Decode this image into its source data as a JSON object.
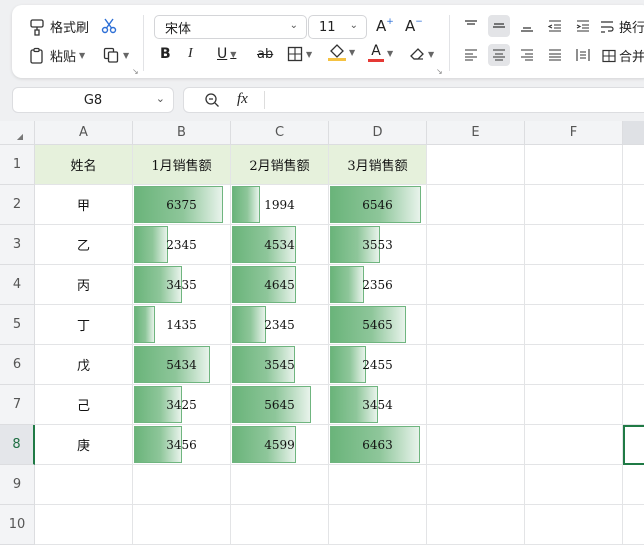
{
  "toolbar": {
    "format_painter": "格式刷",
    "paste": "粘贴",
    "font_name": "宋体",
    "font_size": "11",
    "increase_font": "A",
    "decrease_font": "A",
    "bold": "B",
    "italic": "I",
    "underline": "U",
    "strike": "ab",
    "font_color_letter": "A",
    "wrap_text": "换行",
    "merge_cells": "合并",
    "font_color": "#e53935",
    "fill_color": "#f5c242"
  },
  "formula_bar": {
    "name_box": "G8",
    "fx": "fx",
    "value": ""
  },
  "sheet": {
    "columns": [
      "A",
      "B",
      "C",
      "D",
      "E",
      "F"
    ],
    "rows": [
      "1",
      "2",
      "3",
      "4",
      "5",
      "6",
      "7",
      "8",
      "9",
      "10"
    ],
    "selected_cell": "G8",
    "header_fill": "#e6f1dc",
    "bar_color": "#6ab47a",
    "headers": [
      "姓名",
      "1月销售额",
      "2月销售额",
      "3月销售额"
    ],
    "data": [
      {
        "name": "甲",
        "m1": "6375",
        "m2": "1994",
        "m3": "6546"
      },
      {
        "name": "乙",
        "m1": "2345",
        "m2": "4534",
        "m3": "3553"
      },
      {
        "name": "丙",
        "m1": "3435",
        "m2": "4645",
        "m3": "2356"
      },
      {
        "name": "丁",
        "m1": "1435",
        "m2": "2345",
        "m3": "5465"
      },
      {
        "name": "戊",
        "m1": "5434",
        "m2": "3545",
        "m3": "2455"
      },
      {
        "name": "己",
        "m1": "3425",
        "m2": "5645",
        "m3": "3454"
      },
      {
        "name": "庚",
        "m1": "3456",
        "m2": "4599",
        "m3": "6463"
      }
    ],
    "bar_fraction": [
      [
        0.95,
        0.3,
        0.97
      ],
      [
        0.36,
        0.68,
        0.53
      ],
      [
        0.51,
        0.68,
        0.36
      ],
      [
        0.22,
        0.36,
        0.81
      ],
      [
        0.81,
        0.67,
        0.38
      ],
      [
        0.51,
        0.84,
        0.51
      ],
      [
        0.51,
        0.68,
        0.96
      ]
    ]
  }
}
